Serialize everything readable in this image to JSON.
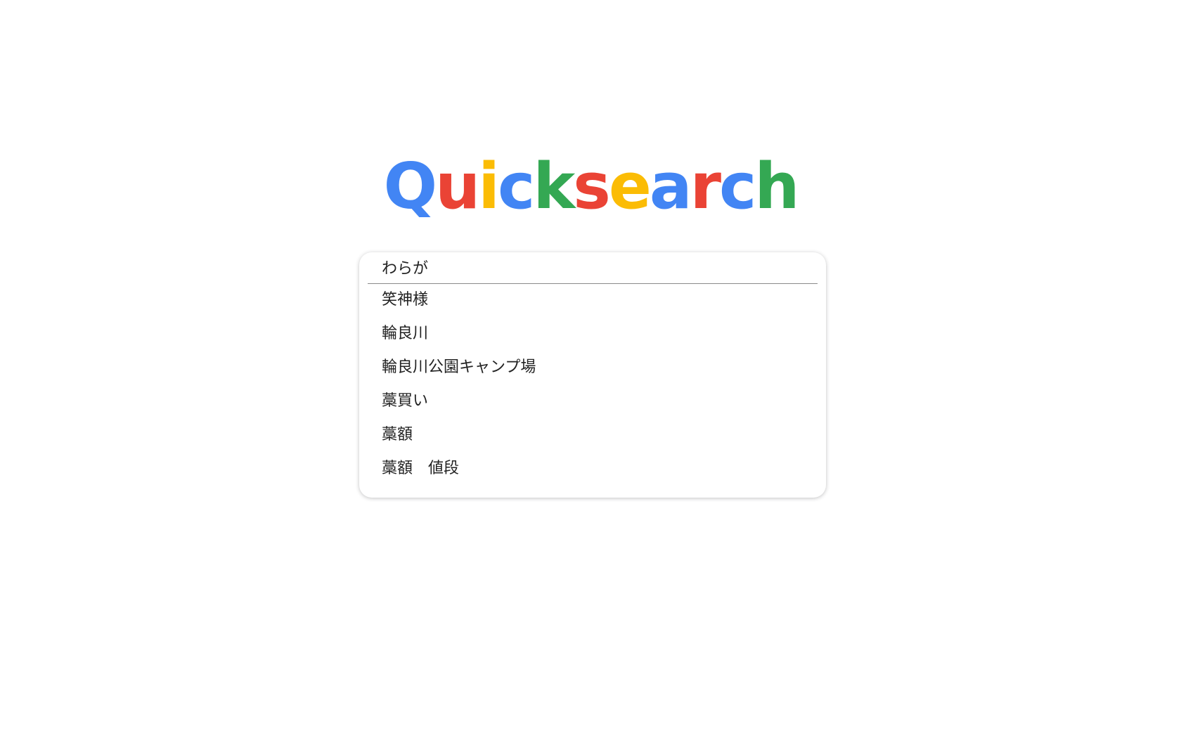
{
  "logo": {
    "letters": [
      {
        "char": "Q",
        "color": "#4285F4"
      },
      {
        "char": "u",
        "color": "#EA4335"
      },
      {
        "char": "i",
        "color": "#FBBC05"
      },
      {
        "char": "c",
        "color": "#4285F4"
      },
      {
        "char": "k",
        "color": "#34A853"
      },
      {
        "char": "s",
        "color": "#EA4335"
      },
      {
        "char": "e",
        "color": "#FBBC05"
      },
      {
        "char": "a",
        "color": "#4285F4"
      },
      {
        "char": "r",
        "color": "#EA4335"
      },
      {
        "char": "c",
        "color": "#4285F4"
      },
      {
        "char": "h",
        "color": "#34A853"
      }
    ]
  },
  "search": {
    "value": "わらが",
    "placeholder": ""
  },
  "suggestions": [
    {
      "label": "笑神様"
    },
    {
      "label": "輪良川"
    },
    {
      "label": "輪良川公園キャンプ場"
    },
    {
      "label": "藁買い"
    },
    {
      "label": "藁額"
    },
    {
      "label": "藁額　値段"
    }
  ]
}
